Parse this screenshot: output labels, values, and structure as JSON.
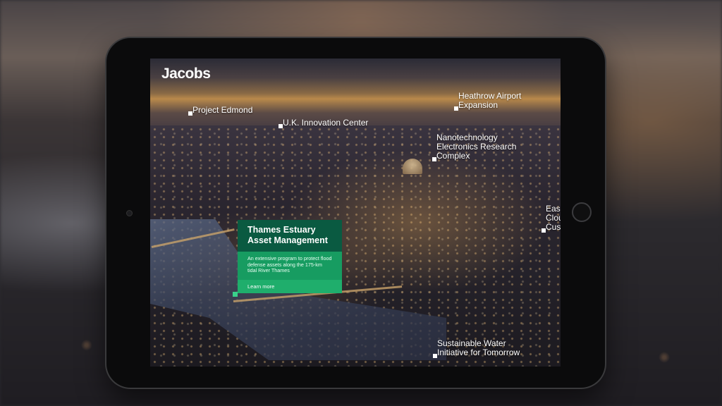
{
  "brand": {
    "logo": "Jacobs"
  },
  "markers": [
    {
      "id": "project-edmond",
      "label": "Project Edmond"
    },
    {
      "id": "uk-innovation-center",
      "label": "U.K. Innovation Center"
    },
    {
      "id": "heathrow",
      "label": "Heathrow Airport\nExpansion"
    },
    {
      "id": "nanotech",
      "label": "Nanotechnology\nElectronics Research\nComplex"
    },
    {
      "id": "east-cloud",
      "label": "Eas\nClou\nCus"
    },
    {
      "id": "sustainable-water",
      "label": "Sustainable Water\nInitiative for Tomorrow"
    }
  ],
  "card": {
    "title": "Thames Estuary Asset Management",
    "description": "An extensive program to protect flood defense assets along the 175-km tidal River Thames",
    "cta": "Learn more"
  },
  "colors": {
    "card_header": "#0a5a41",
    "card_body": "#179c61",
    "accent_green": "#1fae6c",
    "marker": "#ffffff",
    "tablet_bezel": "#0b0b0c"
  }
}
